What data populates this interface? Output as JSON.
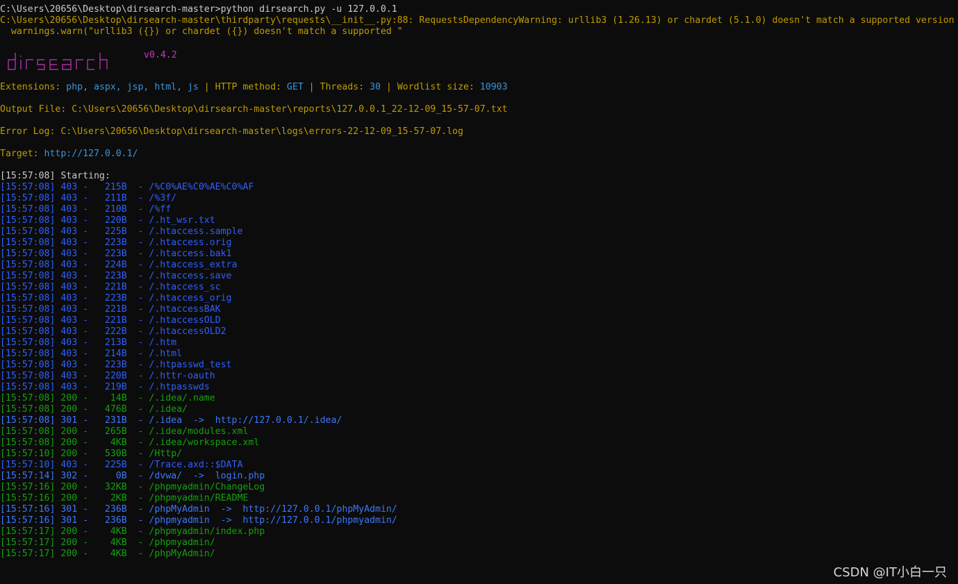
{
  "header": {
    "prompt_line": "C:\\Users\\20656\\Desktop\\dirsearch-master>python dirsearch.py -u 127.0.0.1",
    "warning_line1": "C:\\Users\\20656\\Desktop\\dirsearch-master\\thirdparty\\requests\\__init__.py:88: RequestsDependencyWarning: urllib3 (1.26.13) or chardet (5.1.0) doesn't match a supported version",
    "warning_line2": "  warnings.warn(\"urllib3 ({}) or chardet ({}) doesn't match a supported \""
  },
  "banner": {
    "logo_text": "dirsearch",
    "version": "v0.4.2"
  },
  "config": {
    "extensions_label": "Extensions: ",
    "extensions_value": "php, aspx, jsp, html, js",
    "http_label": "HTTP method: ",
    "http_value": "GET",
    "threads_label": "Threads: ",
    "threads_value": "30",
    "wordlist_label": "Wordlist size: ",
    "wordlist_value": "10903",
    "sep": " | "
  },
  "output_file": {
    "label": "Output File: ",
    "value": "C:\\Users\\20656\\Desktop\\dirsearch-master\\reports\\127.0.0.1_22-12-09_15-57-07.txt"
  },
  "error_log": {
    "label": "Error Log: ",
    "value": "C:\\Users\\20656\\Desktop\\dirsearch-master\\logs\\errors-22-12-09_15-57-07.log"
  },
  "target": {
    "label": "Target: ",
    "value": "http://127.0.0.1/"
  },
  "start": {
    "time": "[15:57:08]",
    "label": " Starting:"
  },
  "results": [
    {
      "time": "[15:57:08]",
      "code": "403",
      "size": "215B",
      "path": "/%C0%AE%C0%AE%C0%AF",
      "redirect": "",
      "color": "blue"
    },
    {
      "time": "[15:57:08]",
      "code": "403",
      "size": "211B",
      "path": "/%3f/",
      "redirect": "",
      "color": "blue"
    },
    {
      "time": "[15:57:08]",
      "code": "403",
      "size": "210B",
      "path": "/%ff",
      "redirect": "",
      "color": "blue"
    },
    {
      "time": "[15:57:08]",
      "code": "403",
      "size": "220B",
      "path": "/.ht_wsr.txt",
      "redirect": "",
      "color": "blue"
    },
    {
      "time": "[15:57:08]",
      "code": "403",
      "size": "225B",
      "path": "/.htaccess.sample",
      "redirect": "",
      "color": "blue"
    },
    {
      "time": "[15:57:08]",
      "code": "403",
      "size": "223B",
      "path": "/.htaccess.orig",
      "redirect": "",
      "color": "blue"
    },
    {
      "time": "[15:57:08]",
      "code": "403",
      "size": "223B",
      "path": "/.htaccess.bak1",
      "redirect": "",
      "color": "blue"
    },
    {
      "time": "[15:57:08]",
      "code": "403",
      "size": "224B",
      "path": "/.htaccess_extra",
      "redirect": "",
      "color": "blue"
    },
    {
      "time": "[15:57:08]",
      "code": "403",
      "size": "223B",
      "path": "/.htaccess.save",
      "redirect": "",
      "color": "blue"
    },
    {
      "time": "[15:57:08]",
      "code": "403",
      "size": "221B",
      "path": "/.htaccess_sc",
      "redirect": "",
      "color": "blue"
    },
    {
      "time": "[15:57:08]",
      "code": "403",
      "size": "223B",
      "path": "/.htaccess_orig",
      "redirect": "",
      "color": "blue"
    },
    {
      "time": "[15:57:08]",
      "code": "403",
      "size": "221B",
      "path": "/.htaccessBAK",
      "redirect": "",
      "color": "blue"
    },
    {
      "time": "[15:57:08]",
      "code": "403",
      "size": "221B",
      "path": "/.htaccessOLD",
      "redirect": "",
      "color": "blue"
    },
    {
      "time": "[15:57:08]",
      "code": "403",
      "size": "222B",
      "path": "/.htaccessOLD2",
      "redirect": "",
      "color": "blue"
    },
    {
      "time": "[15:57:08]",
      "code": "403",
      "size": "213B",
      "path": "/.htm",
      "redirect": "",
      "color": "blue"
    },
    {
      "time": "[15:57:08]",
      "code": "403",
      "size": "214B",
      "path": "/.html",
      "redirect": "",
      "color": "blue"
    },
    {
      "time": "[15:57:08]",
      "code": "403",
      "size": "223B",
      "path": "/.htpasswd_test",
      "redirect": "",
      "color": "blue"
    },
    {
      "time": "[15:57:08]",
      "code": "403",
      "size": "220B",
      "path": "/.httr-oauth",
      "redirect": "",
      "color": "blue"
    },
    {
      "time": "[15:57:08]",
      "code": "403",
      "size": "219B",
      "path": "/.htpasswds",
      "redirect": "",
      "color": "blue"
    },
    {
      "time": "[15:57:08]",
      "code": "200",
      "size": "14B",
      "path": "/.idea/.name",
      "redirect": "",
      "color": "green"
    },
    {
      "time": "[15:57:08]",
      "code": "200",
      "size": "476B",
      "path": "/.idea/",
      "redirect": "",
      "color": "green"
    },
    {
      "time": "[15:57:08]",
      "code": "301",
      "size": "231B",
      "path": "/.idea",
      "redirect": "http://127.0.0.1/.idea/",
      "color": "lblue"
    },
    {
      "time": "[15:57:08]",
      "code": "200",
      "size": "265B",
      "path": "/.idea/modules.xml",
      "redirect": "",
      "color": "green"
    },
    {
      "time": "[15:57:08]",
      "code": "200",
      "size": "4KB",
      "path": "/.idea/workspace.xml",
      "redirect": "",
      "color": "green"
    },
    {
      "time": "[15:57:10]",
      "code": "200",
      "size": "530B",
      "path": "/Http/",
      "redirect": "",
      "color": "green"
    },
    {
      "time": "[15:57:10]",
      "code": "403",
      "size": "225B",
      "path": "/Trace.axd::$DATA",
      "redirect": "",
      "color": "blue"
    },
    {
      "time": "[15:57:14]",
      "code": "302",
      "size": "0B",
      "path": "/dvwa/",
      "redirect": "login.php",
      "color": "lblue"
    },
    {
      "time": "[15:57:16]",
      "code": "200",
      "size": "32KB",
      "path": "/phpmyadmin/ChangeLog",
      "redirect": "",
      "color": "green"
    },
    {
      "time": "[15:57:16]",
      "code": "200",
      "size": "2KB",
      "path": "/phpmyadmin/README",
      "redirect": "",
      "color": "green"
    },
    {
      "time": "[15:57:16]",
      "code": "301",
      "size": "236B",
      "path": "/phpMyAdmin",
      "redirect": "http://127.0.0.1/phpMyAdmin/",
      "color": "lblue"
    },
    {
      "time": "[15:57:16]",
      "code": "301",
      "size": "236B",
      "path": "/phpmyadmin",
      "redirect": "http://127.0.0.1/phpmyadmin/",
      "color": "lblue"
    },
    {
      "time": "[15:57:17]",
      "code": "200",
      "size": "4KB",
      "path": "/phpmyadmin/index.php",
      "redirect": "",
      "color": "green"
    },
    {
      "time": "[15:57:17]",
      "code": "200",
      "size": "4KB",
      "path": "/phpmyadmin/",
      "redirect": "",
      "color": "green"
    },
    {
      "time": "[15:57:17]",
      "code": "200",
      "size": "4KB",
      "path": "/phpMyAdmin/",
      "redirect": "",
      "color": "green"
    }
  ],
  "arrow": "->",
  "watermark": "CSDN @IT小白一只",
  "colors": {
    "background": "#0c0c0c",
    "text": "#cccccc",
    "yellow": "#c19c00",
    "magenta": "#c737c0",
    "cyan": "#3a96dd",
    "blue": "#2f5fff",
    "green": "#13a10e",
    "lblue": "#3b78ff"
  }
}
